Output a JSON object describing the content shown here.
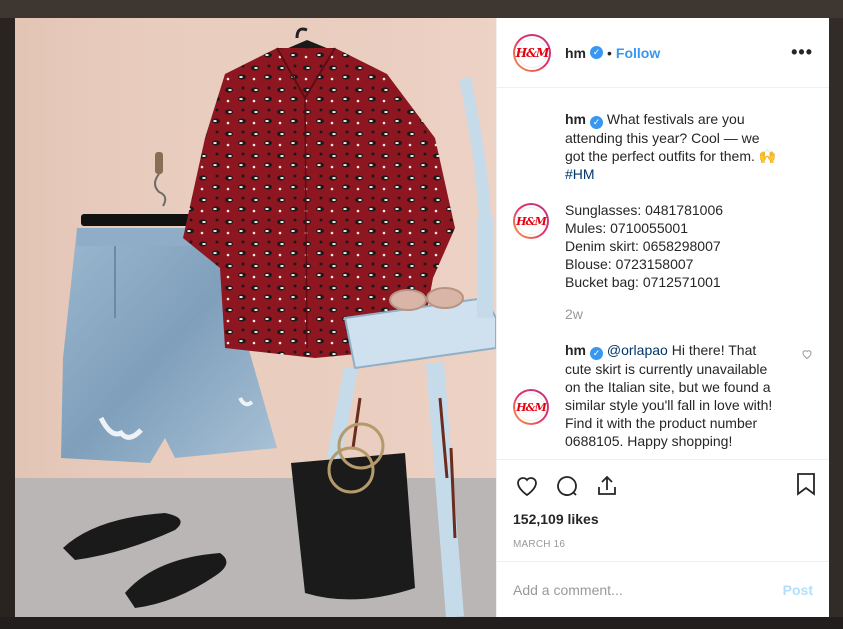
{
  "post": {
    "username": "hm",
    "verified_mark": "✓",
    "separator": "•",
    "follow_label": "Follow",
    "more_label": "•••",
    "avatar_text": "H&M"
  },
  "caption": {
    "username": "hm",
    "text": "What festivals are you attending this year? Cool — we got the perfect outfits for them. ",
    "emoji": "🙌",
    "hashtag": "#HM"
  },
  "products": {
    "lines": [
      "Sunglasses: 0481781006",
      "Mules: 0710055001",
      "Denim skirt: 0658298007",
      "Blouse: 0723158007",
      "Bucket bag: 0712571001"
    ],
    "time": "2w"
  },
  "reply": {
    "username": "hm",
    "mention": "@orlapao",
    "text": " Hi there! That cute skirt is currently unavailable on the Italian site, but we found a similar style you'll fall in love with! Find it with the product number 0688105. Happy shopping!"
  },
  "engagement": {
    "likes": "152,109 likes",
    "date": "MARCH 16"
  },
  "comment_box": {
    "placeholder": "Add a comment...",
    "post_label": "Post"
  },
  "colors": {
    "accent": "#3897f0",
    "brand_red": "#e50010",
    "post_disabled": "#b2dffc"
  }
}
